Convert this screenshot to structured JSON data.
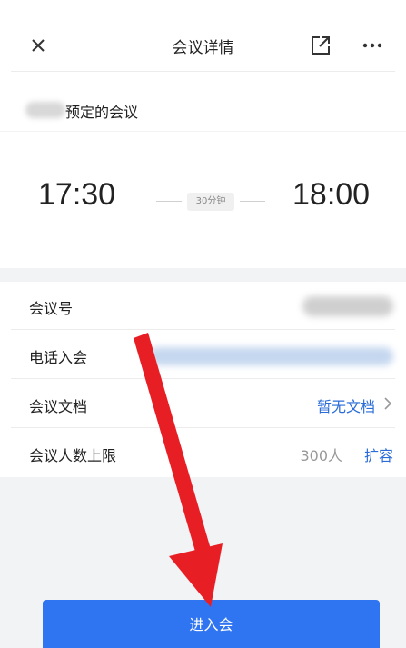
{
  "header": {
    "title": "会议详情",
    "close_icon": "close-icon",
    "share_icon": "external-share-icon",
    "more_icon": "more-dots-icon"
  },
  "organizer": {
    "text": "预定的会议"
  },
  "time": {
    "start": "17:30",
    "end": "18:00",
    "duration": "30分钟"
  },
  "rows": {
    "meeting_id_label": "会议号",
    "phone_label": "电话入会",
    "docs_label": "会议文档",
    "docs_value": "暂无文档",
    "limit_label": "会议人数上限",
    "limit_value": "300人",
    "limit_action": "扩容"
  },
  "join_button": {
    "label": "进入会"
  },
  "colors": {
    "accent": "#2f74f0",
    "link": "#2b6cd8",
    "arrow": "#e81e25",
    "background": "#f2f3f5"
  }
}
